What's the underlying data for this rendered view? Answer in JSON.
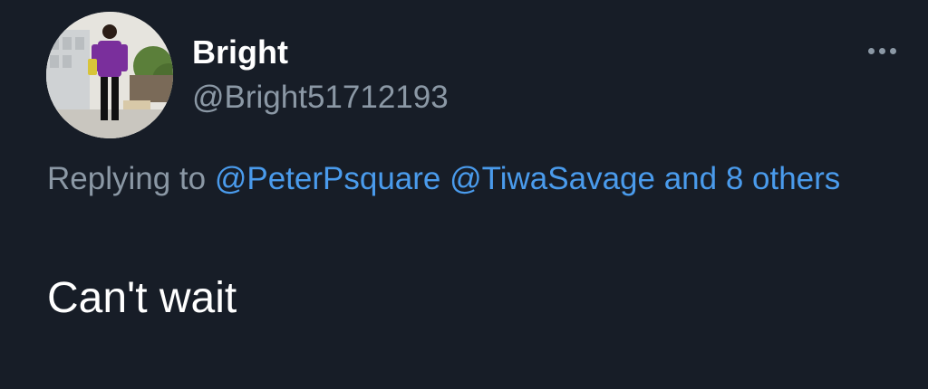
{
  "author": {
    "display_name": "Bright",
    "handle": "@Bright51712193",
    "avatar_icon": "profile-photo"
  },
  "reply": {
    "prefix": "Replying to",
    "mention_1": "@PeterPsquare",
    "mention_2": "@TiwaSavage",
    "others": "and 8 others"
  },
  "tweet": {
    "text": "Can't wait"
  },
  "menu": {
    "icon": "more-options-icon"
  },
  "colors": {
    "background": "#171d27",
    "link": "#4a9bec",
    "muted": "#8b98a5",
    "text": "#ffffff"
  }
}
